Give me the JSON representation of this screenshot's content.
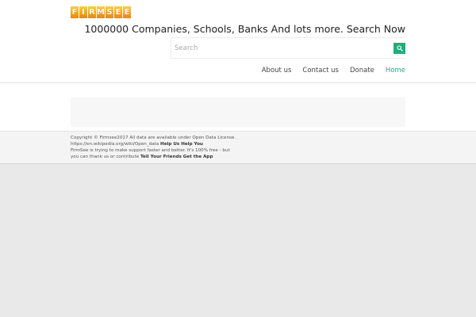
{
  "logo": {
    "letters": [
      "F",
      "I",
      "R",
      "M",
      "S",
      "E",
      "E"
    ]
  },
  "header": {
    "headline": "1000000 Companies, Schools, Banks And lots more. Search Now"
  },
  "search": {
    "placeholder": "Search",
    "value": "",
    "button_icon": "search-icon",
    "button_color": "#1fae7a"
  },
  "nav": {
    "items": [
      {
        "label": "About us"
      },
      {
        "label": "Contact us"
      },
      {
        "label": "Donate"
      },
      {
        "label": "Home",
        "active": true
      }
    ],
    "active_color": "#2aa58f"
  },
  "footer": {
    "copyright": "Copyright © Firmsee2017 All data are available under Open Data License. https://en.wikipedia.org/wiki/Open_data",
    "help_link": "Help Us Help You",
    "support_text": "FirmSee is trying to make support faster and better. It's 100% free - but you can thank us or contribute",
    "tell_link": "Tell Your Friends",
    "app_link": "Get the App"
  }
}
